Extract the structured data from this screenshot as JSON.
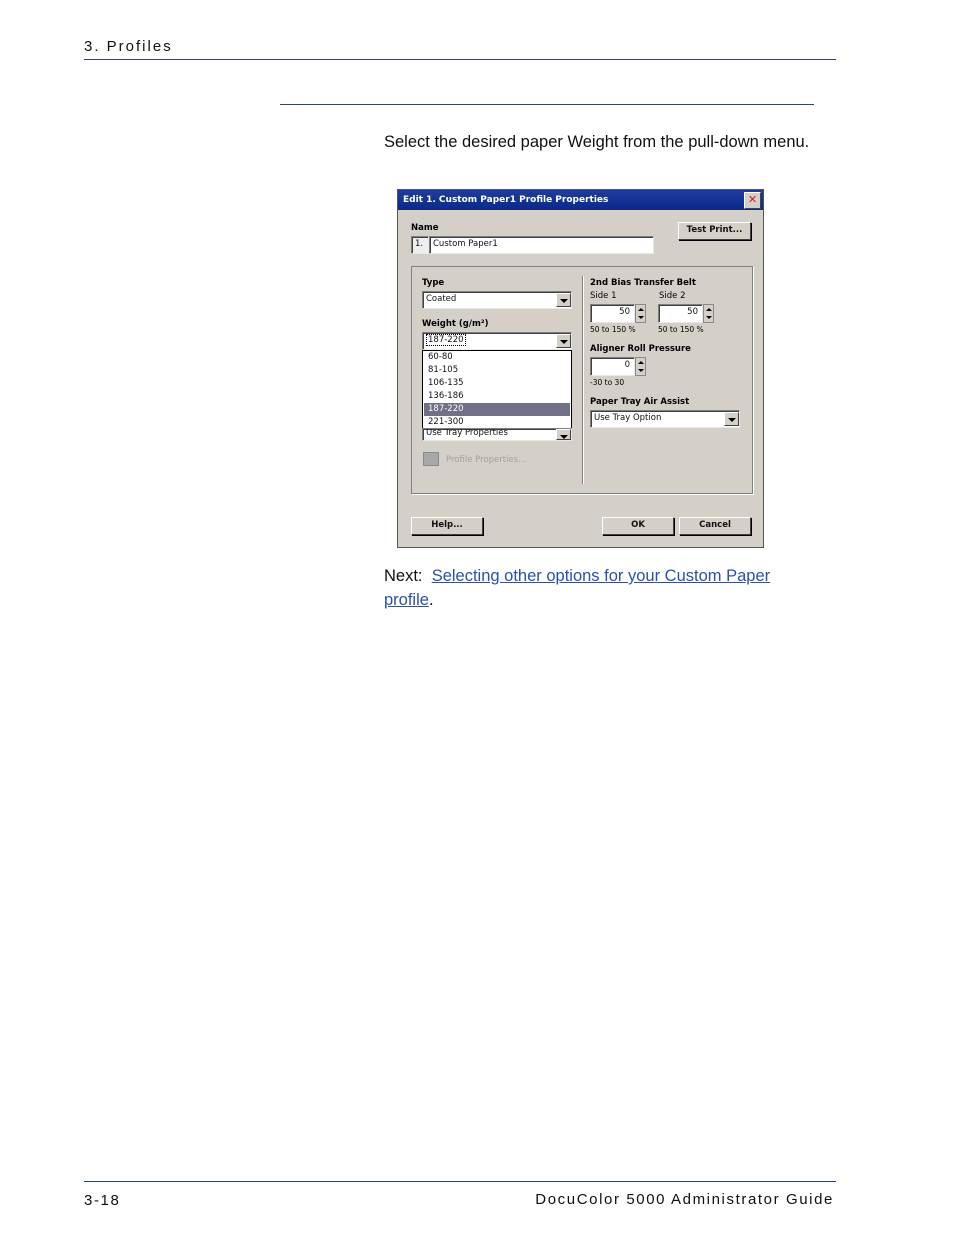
{
  "header": {
    "section": "3. Profiles"
  },
  "instruction": "Select the desired paper Weight from the pull-down menu.",
  "dialog": {
    "title": "Edit 1. Custom Paper1 Profile Properties",
    "close_glyph": "✕",
    "name_label": "Name",
    "name_index": "1.",
    "name_value": "Custom Paper1",
    "test_print_label": "Test Print...",
    "type_label": "Type",
    "type_value": "Coated",
    "weight_label": "Weight (g/m²)",
    "weight_value": "187-220",
    "weight_options": [
      "60-80",
      "81-105",
      "106-135",
      "136-186",
      "187-220",
      "221-300"
    ],
    "weight_selected_index": 4,
    "tray_value": "Use Tray Properties",
    "profile_properties_label": "Profile Properties...",
    "bias_label": "2nd Bias Transfer Belt",
    "side1_label": "Side 1",
    "side2_label": "Side 2",
    "side1_value": "50",
    "side2_value": "50",
    "side1_range": "50 to 150 %",
    "side2_range": "50 to 150 %",
    "aligner_label": "Aligner Roll Pressure",
    "aligner_value": "0",
    "aligner_range": "-30 to 30",
    "air_assist_label": "Paper Tray Air Assist",
    "air_assist_value": "Use Tray Option",
    "help_label": "Help...",
    "ok_label": "OK",
    "cancel_label": "Cancel"
  },
  "next": {
    "prefix": "Next:",
    "link_line1": "Selecting other options for your Custom Paper ",
    "link_line2": "profile",
    "suffix": "."
  },
  "footer": {
    "page_number": "3-18",
    "guide_title": "DocuColor 5000 Administrator Guide"
  }
}
